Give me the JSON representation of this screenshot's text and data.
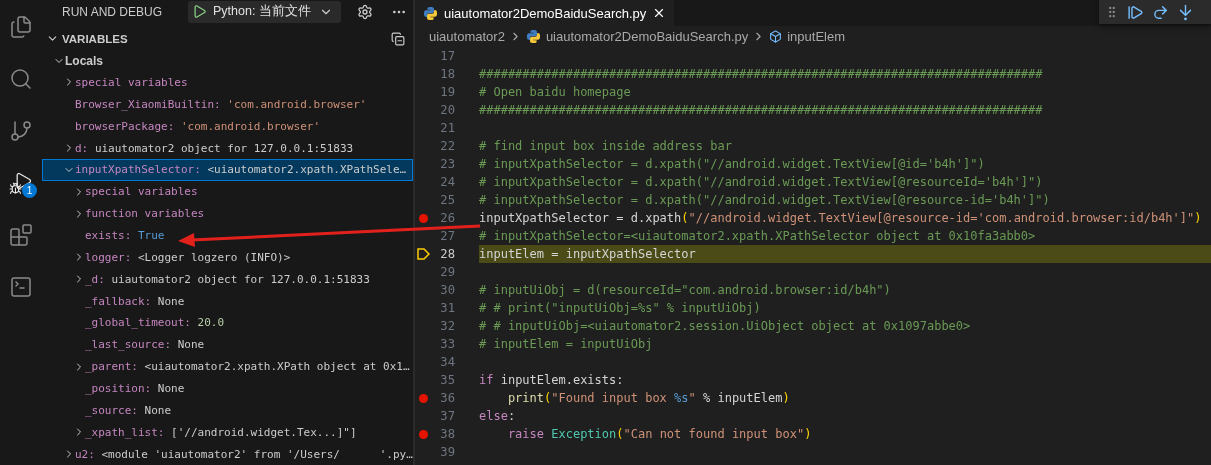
{
  "activity_bar": {
    "items": [
      {
        "kind": "files",
        "selected": false
      },
      {
        "kind": "search",
        "selected": false
      },
      {
        "kind": "source_control",
        "selected": false
      },
      {
        "kind": "run_debug",
        "selected": true,
        "badge": "1"
      },
      {
        "kind": "extensions",
        "selected": false
      },
      {
        "kind": "terminal",
        "selected": false
      }
    ]
  },
  "sidebar": {
    "title": "RUN AND DEBUG",
    "config": "Python: 当前文件",
    "section": {
      "title": "VARIABLES",
      "expanded": true
    },
    "scopes": [
      {
        "name": "Locals",
        "expanded": true,
        "selected": false,
        "children": [
          {
            "name": "special variables",
            "expanded": false,
            "selected": false
          },
          {
            "name": "Browser_XiaomiBuiltin:",
            "value": "'com.android.browser'",
            "color": "#ce9178",
            "selected": false
          },
          {
            "name": "browserPackage:",
            "value": "'com.android.browser'",
            "color": "#ce9178",
            "selected": false
          },
          {
            "name": "d:",
            "value": "uiautomator2 object for 127.0.0.1:51833",
            "color": "#cccccc",
            "expanded": false,
            "selected": false
          },
          {
            "name": "inputXpathSelector:",
            "value": "<uiautomator2.xpath.XPathSele…",
            "color": "#cccccc",
            "expanded": true,
            "selected": true,
            "children": [
              {
                "name": "special variables",
                "expanded": false,
                "selected": false
              },
              {
                "name": "function variables",
                "expanded": false,
                "selected": false
              },
              {
                "name": "exists:",
                "value": "True",
                "color": "#569cd6",
                "selected": false
              },
              {
                "name": "logger:",
                "value": "<Logger logzero (INFO)>",
                "color": "#cccccc",
                "expanded": false,
                "selected": false
              },
              {
                "name": "_d:",
                "value": "uiautomator2 object for 127.0.0.1:51833",
                "color": "#cccccc",
                "expanded": false,
                "selected": false
              },
              {
                "name": "_fallback:",
                "value": "None",
                "color": "#cccccc",
                "selected": false
              },
              {
                "name": "_global_timeout:",
                "value": "20.0",
                "color": "#b5cea8",
                "selected": false
              },
              {
                "name": "_last_source:",
                "value": "None",
                "color": "#cccccc",
                "selected": false
              },
              {
                "name": "_parent:",
                "value": "<uiautomator2.xpath.XPath object at 0x1…",
                "color": "#cccccc",
                "expanded": false,
                "selected": false
              },
              {
                "name": "_position:",
                "value": "None",
                "color": "#cccccc",
                "selected": false
              },
              {
                "name": "_source:",
                "value": "None",
                "color": "#cccccc",
                "selected": false
              },
              {
                "name": "_xpath_list:",
                "value": "['//android.widget.Tex...]\"]",
                "color": "#cccccc",
                "expanded": false,
                "selected": false
              }
            ]
          },
          {
            "name": "u2:",
            "value": "<module 'uiautomator2' from '/Users/      '.py…",
            "color": "#cccccc",
            "expanded": false,
            "selected": false
          }
        ]
      }
    ]
  },
  "editor": {
    "tab": {
      "label": "uiautomator2DemoBaiduSearch.py",
      "selected": true
    },
    "breadcrumbs": [
      {
        "kind": "folder",
        "label": "uiautomator2"
      },
      {
        "kind": "python",
        "label": "uiautomator2DemoBaiduSearch.py"
      },
      {
        "kind": "symbol",
        "label": "inputElem"
      }
    ],
    "lines": [
      {
        "number": "17",
        "breakpoint": false,
        "current": false
      },
      {
        "number": "18",
        "breakpoint": false,
        "current": false,
        "tokens": [
          {
            "kind": "comment",
            "text": "##############################################################################"
          }
        ]
      },
      {
        "number": "19",
        "breakpoint": false,
        "current": false,
        "tokens": [
          {
            "kind": "comment",
            "text": "# Open baidu homepage"
          }
        ]
      },
      {
        "number": "20",
        "breakpoint": false,
        "current": false,
        "tokens": [
          {
            "kind": "comment",
            "text": "##############################################################################"
          }
        ]
      },
      {
        "number": "21",
        "breakpoint": false,
        "current": false
      },
      {
        "number": "22",
        "breakpoint": false,
        "current": false,
        "tokens": [
          {
            "kind": "comment",
            "text": "# find input box inside address bar"
          }
        ]
      },
      {
        "number": "23",
        "breakpoint": false,
        "current": false,
        "tokens": [
          {
            "kind": "comment",
            "text": "# inputXpathSelector = d.xpath(\"//android.widget.TextView[@id='b4h']\")"
          }
        ]
      },
      {
        "number": "24",
        "breakpoint": false,
        "current": false,
        "tokens": [
          {
            "kind": "comment",
            "text": "# inputXpathSelector = d.xpath(\"//android.widget.TextView[@resourceId='b4h']\")"
          }
        ]
      },
      {
        "number": "25",
        "breakpoint": false,
        "current": false,
        "tokens": [
          {
            "kind": "comment",
            "text": "# inputXpathSelector = d.xpath(\"//android.widget.TextView[@resource-id='b4h']\")"
          }
        ]
      },
      {
        "number": "26",
        "breakpoint": true,
        "current": false,
        "tokens": [
          {
            "kind": "plain",
            "text": "inputXpathSelector = d.xpath"
          },
          {
            "kind": "bracket",
            "text": "("
          },
          {
            "kind": "string",
            "text": "\"//android.widget.TextView[@resource-id='com.android.browser:id/b4h']\""
          },
          {
            "kind": "bracket",
            "text": ")"
          }
        ]
      },
      {
        "number": "27",
        "breakpoint": false,
        "current": false,
        "tokens": [
          {
            "kind": "comment",
            "text": "# inputXpathSelector=<uiautomator2.xpath.XPathSelector object at 0x10fa3abb0>"
          }
        ]
      },
      {
        "number": "28",
        "breakpoint": false,
        "current": true,
        "tokens": [
          {
            "kind": "plain",
            "text": "inputElem = inputXpathSelector"
          }
        ]
      },
      {
        "number": "29",
        "breakpoint": false,
        "current": false
      },
      {
        "number": "30",
        "breakpoint": false,
        "current": false,
        "tokens": [
          {
            "kind": "comment",
            "text": "# inputUiObj = d(resourceId=\"com.android.browser:id/b4h\")"
          }
        ]
      },
      {
        "number": "31",
        "breakpoint": false,
        "current": false,
        "tokens": [
          {
            "kind": "comment",
            "text": "# # print(\"inputUiObj=%s\" % inputUiObj)"
          }
        ]
      },
      {
        "number": "32",
        "breakpoint": false,
        "current": false,
        "tokens": [
          {
            "kind": "comment",
            "text": "# # inputUiObj=<uiautomator2.session.UiObject object at 0x1097abbe0>"
          }
        ]
      },
      {
        "number": "33",
        "breakpoint": false,
        "current": false,
        "tokens": [
          {
            "kind": "comment",
            "text": "# inputElem = inputUiObj"
          }
        ]
      },
      {
        "number": "34",
        "breakpoint": false,
        "current": false
      },
      {
        "number": "35",
        "breakpoint": false,
        "current": false,
        "tokens": [
          {
            "kind": "keyword",
            "text": "if"
          },
          {
            "kind": "plain",
            "text": " inputElem.exists:"
          }
        ]
      },
      {
        "number": "36",
        "breakpoint": true,
        "current": false,
        "indented": true,
        "tokens": [
          {
            "kind": "function",
            "text": "print"
          },
          {
            "kind": "bracket",
            "text": "("
          },
          {
            "kind": "string",
            "text": "\"Found input box "
          },
          {
            "kind": "format",
            "text": "%s"
          },
          {
            "kind": "string",
            "text": "\""
          },
          {
            "kind": "plain",
            "text": " % inputElem"
          },
          {
            "kind": "bracket",
            "text": ")"
          }
        ]
      },
      {
        "number": "37",
        "breakpoint": false,
        "current": false,
        "tokens": [
          {
            "kind": "keyword",
            "text": "else"
          },
          {
            "kind": "plain",
            "text": ":"
          }
        ]
      },
      {
        "number": "38",
        "breakpoint": true,
        "current": false,
        "indented": true,
        "tokens": [
          {
            "kind": "keyword",
            "text": "raise "
          },
          {
            "kind": "class",
            "text": "Exception"
          },
          {
            "kind": "bracket",
            "text": "("
          },
          {
            "kind": "string",
            "text": "\"Can not found input box\""
          },
          {
            "kind": "bracket",
            "text": ")"
          }
        ]
      },
      {
        "number": "39",
        "breakpoint": false,
        "current": false
      }
    ]
  },
  "debug_toolbar": {
    "buttons": [
      {
        "kind": "grip"
      },
      {
        "kind": "continue"
      },
      {
        "kind": "step_over"
      },
      {
        "kind": "step_into"
      }
    ]
  }
}
